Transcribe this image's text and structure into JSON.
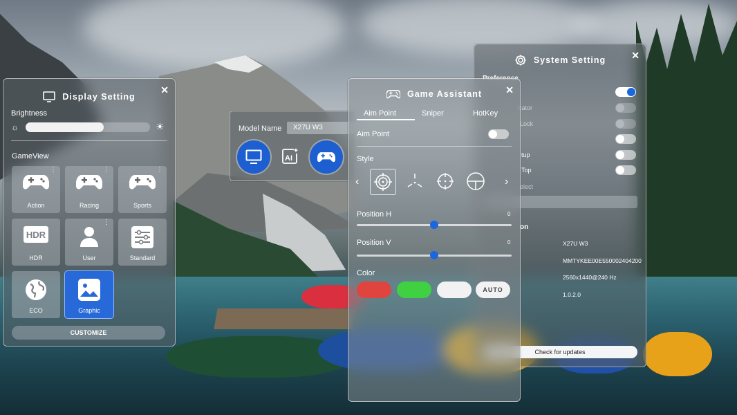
{
  "display_setting": {
    "title": "Display Setting",
    "close": "✕",
    "brightness_label": "Brightness",
    "brightness_level": 0.63,
    "gameview_label": "GameView",
    "tiles": [
      {
        "label": "Action",
        "icon": "gamepad-icon",
        "dots": true
      },
      {
        "label": "Racing",
        "icon": "gamepad-icon",
        "dots": true
      },
      {
        "label": "Sports",
        "icon": "gamepad-icon",
        "dots": true
      },
      {
        "label": "HDR",
        "icon": "hdr-icon",
        "dots": false
      },
      {
        "label": "User",
        "icon": "user-icon",
        "dots": true
      },
      {
        "label": "Standard",
        "icon": "sliders-icon",
        "dots": false
      },
      {
        "label": "ECO",
        "icon": "globe-icon",
        "dots": false
      },
      {
        "label": "Graphic",
        "icon": "image-icon",
        "dots": false,
        "active": true
      }
    ],
    "customize_label": "CUSTOMIZE"
  },
  "model_popup": {
    "label": "Model Name",
    "value": "X27U W3"
  },
  "game_assistant": {
    "title": "Game Assistant",
    "close": "✕",
    "tabs": [
      "Aim Point",
      "Sniper",
      "HotKey"
    ],
    "active_tab": "Aim Point",
    "aim_point_label": "Aim Point",
    "aim_point_on": false,
    "style_label": "Style",
    "position_h_label": "Position H",
    "position_h_value": "0",
    "position_v_label": "Position V",
    "position_v_value": "0",
    "color_label": "Color",
    "auto_label": "AUTO",
    "colors": {
      "red": "#e0443e",
      "green": "#3fd142",
      "white": "#f2f2f2",
      "accent": "#1b67e0"
    }
  },
  "system_setting": {
    "title": "System Setting",
    "close": "✕",
    "partial_labels": [
      "Preference",
      "icator",
      "Lock",
      "tup",
      "Top",
      "elect",
      "on"
    ],
    "toggles": [
      true,
      false,
      false,
      false,
      false,
      false
    ],
    "info": [
      "X27U W3",
      "MMTYKEE00E550002404200",
      "2560x1440@240 Hz",
      "1.0.2.0"
    ],
    "check_updates": "Check for updates"
  }
}
